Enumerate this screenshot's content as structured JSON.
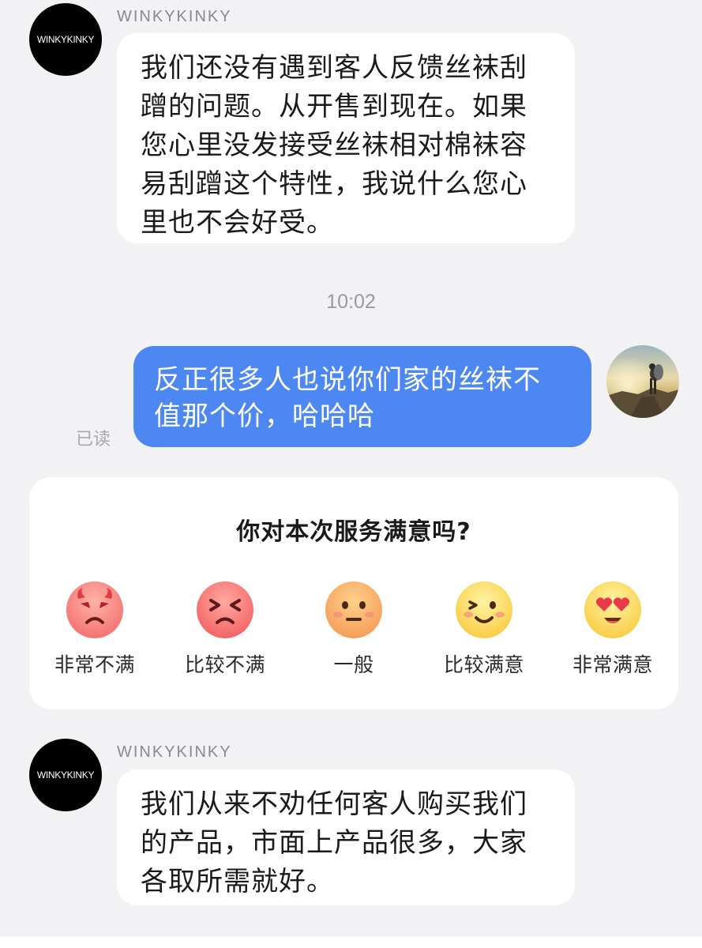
{
  "messages": [
    {
      "sender": "WINKYKINKY",
      "avatar_text": "WINKYKINKY",
      "lines": [
        "我们还没有遇到客人反馈丝袜刮",
        "蹭的问题。从开售到现在。如果",
        "您心里没发接受丝袜相对棉袜容",
        "易刮蹭这个特性，我说什么您心",
        "里也不会好受。"
      ]
    },
    {
      "timestamp": "10:02"
    },
    {
      "read_status": "已读",
      "lines": [
        "反正很多人也说你们家的丝袜不",
        "值那个价，哈哈哈"
      ]
    },
    {
      "sender": "WINKYKINKY",
      "avatar_text": "WINKYKINKY",
      "lines": [
        "我们从来不劝任何客人购买我们",
        "的产品，市面上产品很多，大家",
        "各取所需就好。"
      ]
    }
  ],
  "survey": {
    "title": "你对本次服务满意吗?",
    "options": [
      {
        "label": "非常不满",
        "icon": "very-angry-face-icon"
      },
      {
        "label": "比较不满",
        "icon": "frustrated-face-icon"
      },
      {
        "label": "一般",
        "icon": "neutral-face-icon"
      },
      {
        "label": "比较满意",
        "icon": "winking-smile-face-icon"
      },
      {
        "label": "非常满意",
        "icon": "heart-eyes-face-icon"
      }
    ]
  },
  "colors": {
    "background": "#f2f2f4",
    "outgoing_bubble": "#4d87f1",
    "incoming_bubble": "#ffffff"
  }
}
